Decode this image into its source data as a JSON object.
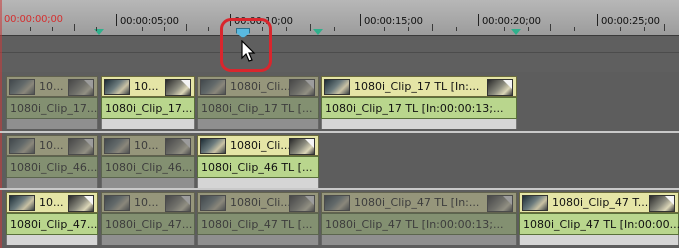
{
  "ruler": {
    "labels": [
      "00:00:00;00",
      "00:00:05;00",
      "00:00:10;00",
      "00:00:15;00",
      "00:00:20;00",
      "00:00:25;00"
    ]
  },
  "tracks": {
    "v1": {
      "clips": [
        {
          "video": "10...",
          "audio": "1080i_Clip_17..."
        },
        {
          "video": "10...",
          "audio": "1080i_Clip_17..."
        },
        {
          "video": "1080i_Cli...",
          "audio": "1080i_Clip_17  TL [..."
        },
        {
          "video": "1080i_Clip_17  TL [In:...",
          "audio": "1080i_Clip_17  TL [In:00:00:13;..."
        }
      ]
    },
    "v2": {
      "clips": [
        {
          "video": "10...",
          "audio": "1080i_Clip_46..."
        },
        {
          "video": "10...",
          "audio": "1080i_Clip_46..."
        },
        {
          "video": "1080i_Cli...",
          "audio": "1080i_Clip_46  TL [..."
        }
      ]
    },
    "v3": {
      "clips": [
        {
          "video": "10...",
          "audio": "1080i_Clip_47..."
        },
        {
          "video": "10...",
          "audio": "1080i_Clip_47..."
        },
        {
          "video": "1080i_Cli...",
          "audio": "1080i_Clip_47  TL [..."
        },
        {
          "video": "1080i_Clip_47  TL [In:...",
          "audio": "1080i_Clip_47  TL [In:00:00:13;..."
        },
        {
          "video": "1080i_Clip_47  T...",
          "audio": "1080i_Clip_47  TL [In:00:00...."
        }
      ]
    }
  },
  "icons": [
    "playhead-icon",
    "mouse-pointer-icon",
    "clip-thumbnail-icon"
  ]
}
